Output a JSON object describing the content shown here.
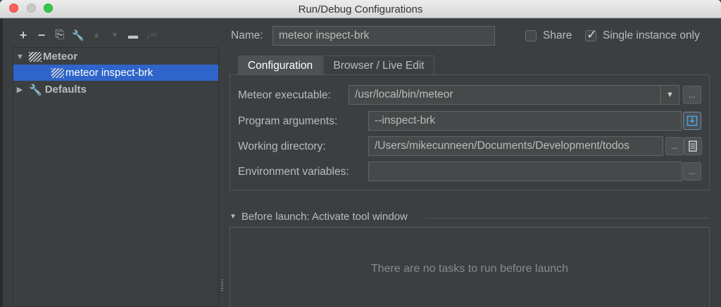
{
  "window": {
    "title": "Run/Debug Configurations"
  },
  "toolbar": {
    "add": "+",
    "remove": "−",
    "copy": "⎘",
    "edit_defaults": "🔧",
    "move_up": "▲",
    "move_down": "▼",
    "folder": "▬",
    "sort": "↓ᵃᶻ"
  },
  "tree": {
    "group": {
      "label": "Meteor"
    },
    "selected_item": {
      "label": "meteor inspect-brk"
    },
    "defaults": {
      "label": "Defaults"
    }
  },
  "header": {
    "name_label": "Name:",
    "name_value": "meteor inspect-brk",
    "share_label": "Share",
    "share_checked": false,
    "single_instance_label": "Single instance only",
    "single_instance_checked": true
  },
  "tabs": [
    {
      "label": "Configuration",
      "active": true
    },
    {
      "label": "Browser / Live Edit",
      "active": false
    }
  ],
  "config": {
    "executable_label": "Meteor executable:",
    "executable_value": "/usr/local/bin/meteor",
    "program_args_label": "Program arguments:",
    "program_args_value": "--inspect-brk",
    "working_dir_label": "Working directory:",
    "working_dir_value": "/Users/mikecunneen/Documents/Development/todos",
    "env_vars_label": "Environment variables:",
    "env_vars_value": "",
    "browse_label": "..."
  },
  "before_launch": {
    "title": "Before launch: Activate tool window",
    "empty_message": "There are no tasks to run before launch"
  },
  "colors": {
    "background": "#3c3f41",
    "selection": "#2f65ca",
    "field": "#45494a"
  }
}
